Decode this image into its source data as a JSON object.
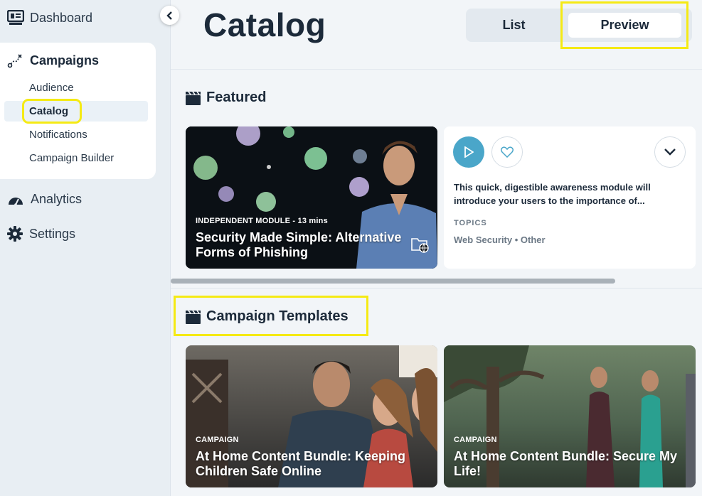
{
  "sidebar": {
    "dashboard": "Dashboard",
    "campaigns": {
      "title": "Campaigns",
      "items": [
        "Audience",
        "Catalog",
        "Notifications",
        "Campaign Builder"
      ],
      "active": "Catalog"
    },
    "analytics": "Analytics",
    "settings": "Settings",
    "collapse_icon": "chevron-left-icon"
  },
  "header": {
    "title": "Catalog",
    "view_toggle": {
      "list": "List",
      "preview": "Preview",
      "selected": "Preview"
    }
  },
  "featured": {
    "title": "Featured",
    "card": {
      "label": "INDEPENDENT MODULE  - 13 mins",
      "title": "Security Made Simple: Alternative Forms of Phishing",
      "description": "This quick, digestible awareness module will introduce your users to the importance of...",
      "topics_label": "TOPICS",
      "topics": "Web Security • Other"
    }
  },
  "templates": {
    "title": "Campaign Templates",
    "cards": [
      {
        "label": "CAMPAIGN",
        "title": "At Home Content Bundle: Keeping Children Safe Online"
      },
      {
        "label": "CAMPAIGN",
        "title": "At Home Content Bundle: Secure My Life!"
      }
    ]
  },
  "colors": {
    "highlight": "#f5ea14",
    "accent": "#4aa6c9",
    "text": "#1c2a3a"
  }
}
